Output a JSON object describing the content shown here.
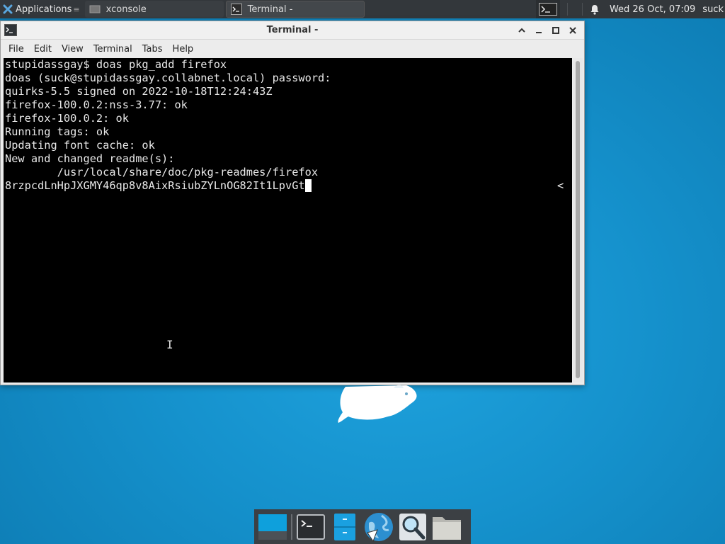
{
  "top_panel": {
    "applications_label": "Applications",
    "tasks": [
      {
        "label": "xconsole"
      },
      {
        "label": "Terminal -"
      }
    ],
    "clock": "Wed 26 Oct, 07:09",
    "user": "suck"
  },
  "window": {
    "title": "Terminal -",
    "menu": [
      "File",
      "Edit",
      "View",
      "Terminal",
      "Tabs",
      "Help"
    ]
  },
  "terminal": {
    "lines": [
      "stupidassgay$ doas pkg_add firefox",
      "doas (suck@stupidassgay.collabnet.local) password:",
      "quirks-5.5 signed on 2022-10-18T12:24:43Z",
      "firefox-100.0.2:nss-3.77: ok",
      "firefox-100.0.2: ok",
      "Running tags: ok",
      "Updating font cache: ok",
      "New and changed readme(s):",
      "        /usr/local/share/doc/pkg-readmes/firefox"
    ],
    "input_line": "8rzpcdLnHpJXGMY46qp8v8AixRsiubZYLnOG82It1LpvGt",
    "right_marker": "<"
  },
  "colors": {
    "desktop": "#1591cc",
    "panel": "#33373b",
    "terminal_bg": "#000000",
    "terminal_fg": "#e8e8e8"
  },
  "dock": {
    "items": [
      "show-desktop-icon",
      "terminal-icon",
      "file-cabinet-icon",
      "web-browser-icon",
      "search-icon",
      "folder-icon"
    ]
  }
}
